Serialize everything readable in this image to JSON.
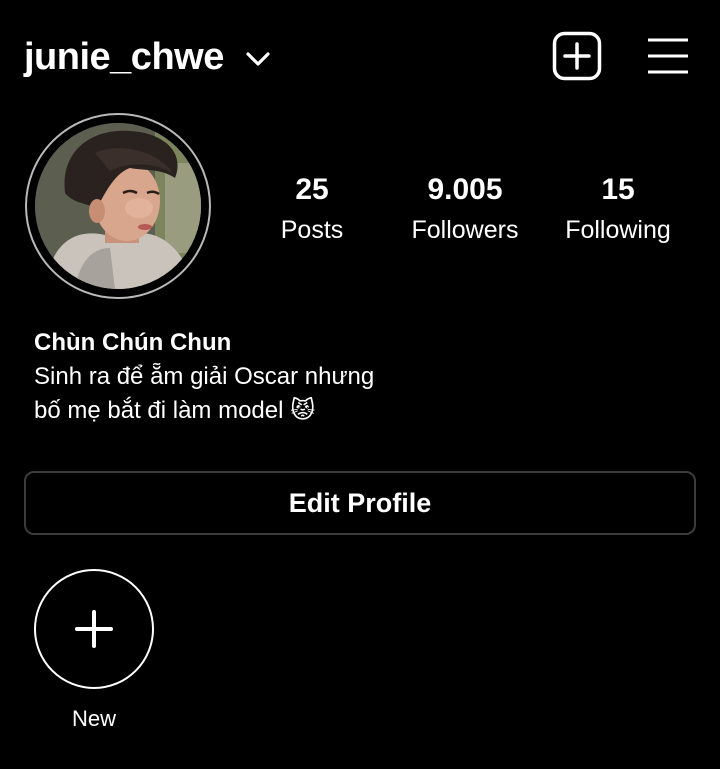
{
  "header": {
    "username": "junie_chwe",
    "switch_account_icon": "chevron-down-icon",
    "new_post_icon": "plus-square-icon",
    "menu_icon": "hamburger-menu-icon"
  },
  "profile": {
    "avatar_icon": "profile-photo",
    "stats": [
      {
        "value": "25",
        "label": "Posts"
      },
      {
        "value": "9.005",
        "label": "Followers"
      },
      {
        "value": "15",
        "label": "Following"
      }
    ],
    "display_name": "Chùn Chún Chun",
    "bio_lines": [
      "Sinh ra để ẵm giải Oscar nhưng",
      "bố mẹ bắt đi làm model 😾"
    ]
  },
  "actions": {
    "edit_profile_label": "Edit Profile"
  },
  "highlights": {
    "new_label": "New",
    "new_icon": "plus-icon"
  },
  "colors": {
    "background": "#000000",
    "text": "#ffffff",
    "button_border": "#3c3c3c",
    "avatar_ring": "#b9b9b9"
  }
}
